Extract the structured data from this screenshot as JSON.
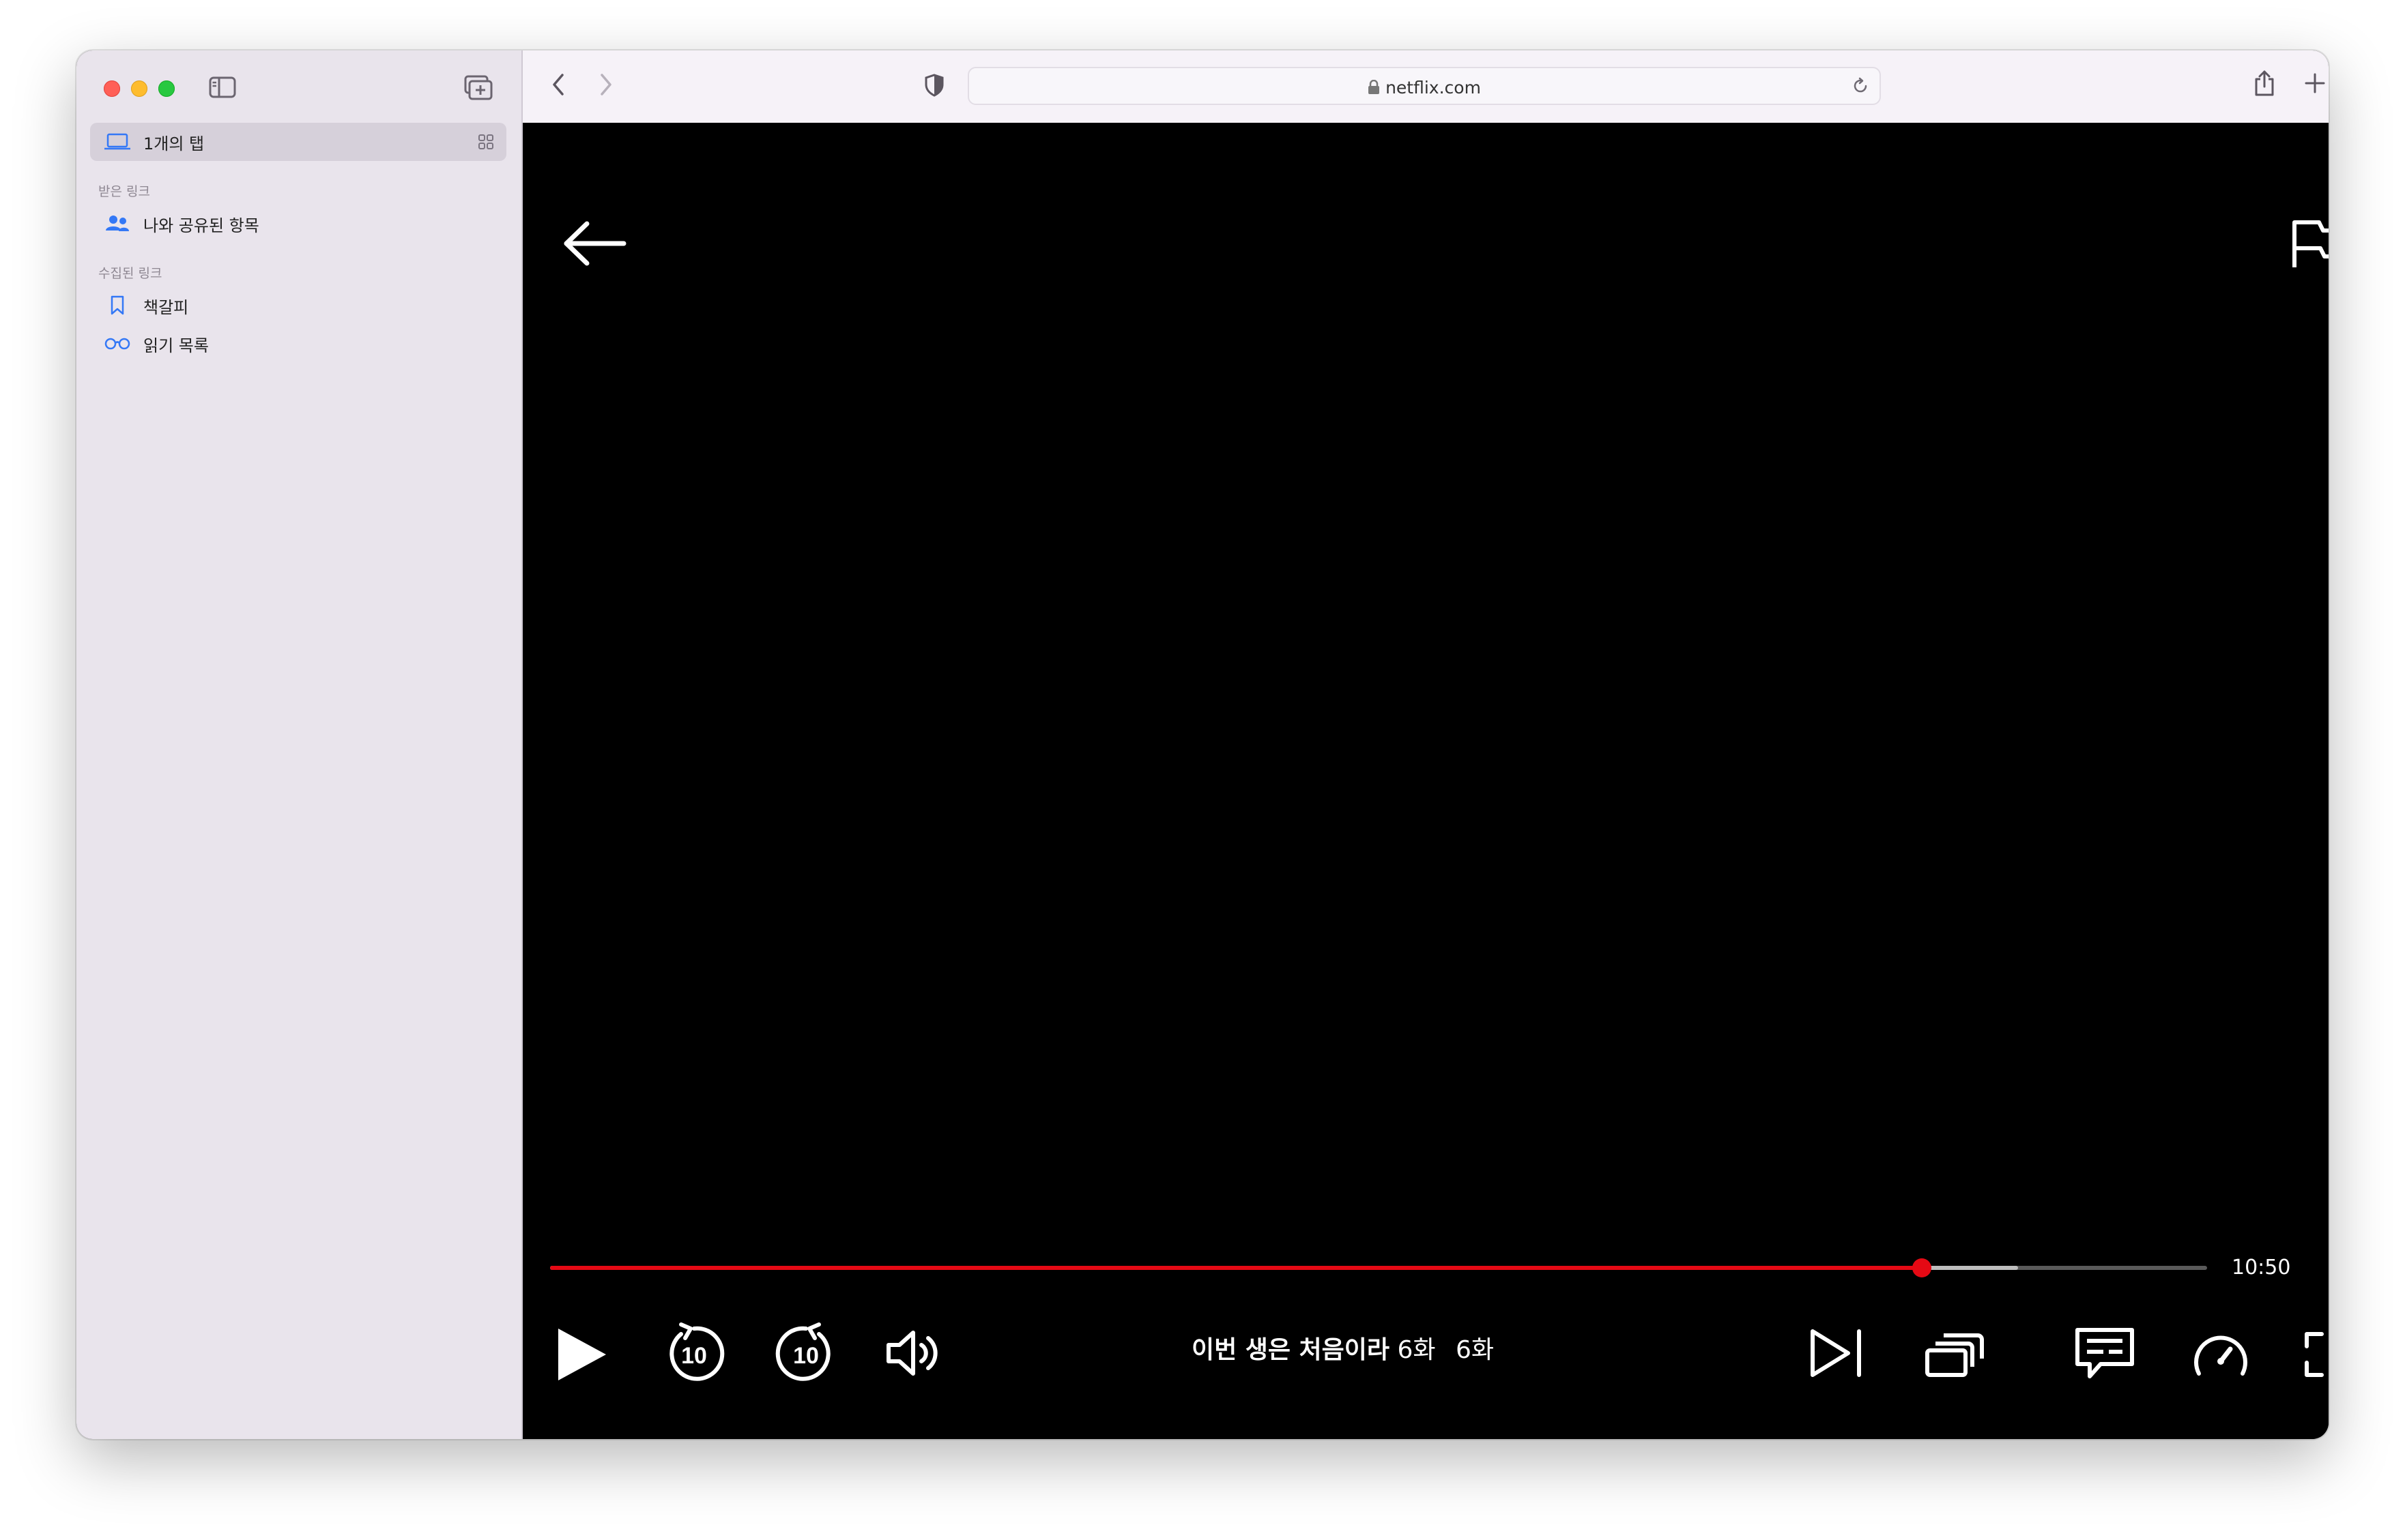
{
  "sidebar": {
    "tabs_item": {
      "label": "1개의 탭"
    },
    "received_links": {
      "heading": "받은 링크",
      "items": [
        {
          "label": "나와 공유된 항목",
          "icon": "shared-people-icon"
        }
      ]
    },
    "collected_links": {
      "heading": "수집된 링크",
      "items": [
        {
          "label": "책갈피",
          "icon": "bookmark-icon"
        },
        {
          "label": "읽기 목록",
          "icon": "reading-glasses-icon"
        }
      ]
    }
  },
  "toolbar": {
    "url": "netflix.com"
  },
  "player": {
    "time_remaining": "10:50",
    "progress_fraction": 0.828,
    "buffered_fraction": 0.886,
    "show_title": "이번 생은 처음이라",
    "episode_code": "6화",
    "episode_title": "6화",
    "skip_seconds": "10",
    "accent_color": "#e50914"
  }
}
